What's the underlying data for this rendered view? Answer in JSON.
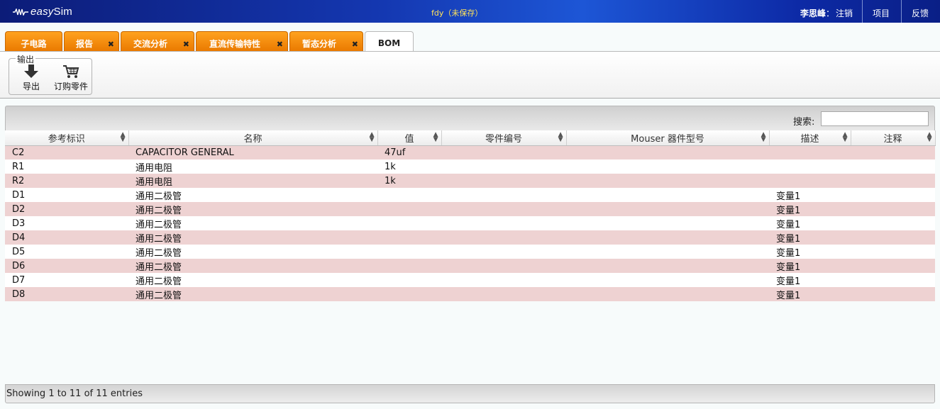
{
  "header": {
    "logo_prefix": "easy",
    "logo_suffix": "Sim",
    "doc_title": "fdy（未保存）",
    "user_name": "李思峰",
    "user_sep": "：",
    "logout": "注销",
    "project": "项目",
    "feedback": "反馈"
  },
  "tabs": [
    {
      "label": "子电路",
      "closable": false
    },
    {
      "label": "报告",
      "closable": true
    },
    {
      "label": "交流分析",
      "closable": true
    },
    {
      "label": "直流传输特性",
      "closable": true
    },
    {
      "label": "暂态分析",
      "closable": true
    },
    {
      "label": "BOM",
      "closable": false,
      "active": true
    }
  ],
  "toolbar": {
    "group_label": "输出",
    "export_label": "导出",
    "order_label": "订购零件"
  },
  "search": {
    "label": "搜索:",
    "value": ""
  },
  "table": {
    "columns": [
      "参考标识",
      "名称",
      "值",
      "零件编号",
      "Mouser 器件型号",
      "描述",
      "注释"
    ],
    "rows": [
      [
        "C2",
        "CAPACITOR GENERAL",
        "47uf",
        "",
        "",
        "",
        ""
      ],
      [
        "R1",
        "通用电阻",
        "1k",
        "",
        "",
        "",
        ""
      ],
      [
        "R2",
        "通用电阻",
        "1k",
        "",
        "",
        "",
        ""
      ],
      [
        "D1",
        "通用二极管",
        "",
        "",
        "",
        "变量1",
        ""
      ],
      [
        "D2",
        "通用二极管",
        "",
        "",
        "",
        "变量1",
        ""
      ],
      [
        "D3",
        "通用二极管",
        "",
        "",
        "",
        "变量1",
        ""
      ],
      [
        "D4",
        "通用二极管",
        "",
        "",
        "",
        "变量1",
        ""
      ],
      [
        "D5",
        "通用二极管",
        "",
        "",
        "",
        "变量1",
        ""
      ],
      [
        "D6",
        "通用二极管",
        "",
        "",
        "",
        "变量1",
        ""
      ],
      [
        "D7",
        "通用二极管",
        "",
        "",
        "",
        "变量1",
        ""
      ],
      [
        "D8",
        "通用二极管",
        "",
        "",
        "",
        "变量1",
        ""
      ]
    ]
  },
  "footer": {
    "info": "Showing 1 to 11 of 11 entries"
  },
  "colors": {
    "header_blue": "#1437b0",
    "tab_orange": "#f08a00",
    "row_pink": "#eed2d2",
    "title_yellow": "#ffe25a"
  },
  "icons": {
    "logo": "waveform-icon",
    "export": "download-arrow-icon",
    "order": "shopping-cart-icon",
    "tab_close": "close-icon",
    "sort": "sort-icon"
  }
}
